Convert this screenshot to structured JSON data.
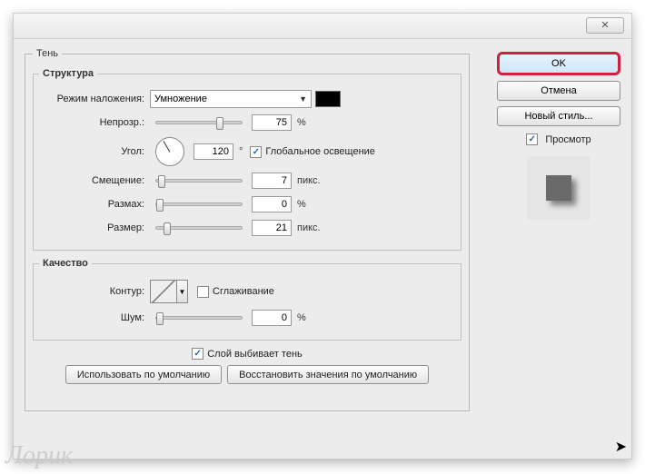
{
  "window": {
    "close_glyph": "✕"
  },
  "main_group": {
    "legend": "Тень"
  },
  "structure": {
    "legend": "Структура",
    "blend_mode_label": "Режим наложения:",
    "blend_mode_value": "Умножение",
    "opacity_label": "Непрозр.:",
    "opacity_value": "75",
    "opacity_unit": "%",
    "angle_label": "Угол:",
    "angle_value": "120",
    "angle_unit": "°",
    "global_light_label": "Глобальное освещение",
    "global_light_checked": true,
    "distance_label": "Смещение:",
    "distance_value": "7",
    "distance_unit": "пикс.",
    "spread_label": "Размах:",
    "spread_value": "0",
    "spread_unit": "%",
    "size_label": "Размер:",
    "size_value": "21",
    "size_unit": "пикс."
  },
  "quality": {
    "legend": "Качество",
    "contour_label": "Контур:",
    "antialias_label": "Сглаживание",
    "antialias_checked": false,
    "noise_label": "Шум:",
    "noise_value": "0",
    "noise_unit": "%"
  },
  "footer": {
    "knockout_label": "Слой выбивает тень",
    "knockout_checked": true,
    "use_default_label": "Использовать по умолчанию",
    "restore_default_label": "Восстановить значения по умолчанию"
  },
  "side": {
    "ok": "OK",
    "cancel": "Отмена",
    "new_style": "Новый стиль...",
    "preview_label": "Просмотр",
    "preview_checked": true
  },
  "watermark": "Лорик"
}
